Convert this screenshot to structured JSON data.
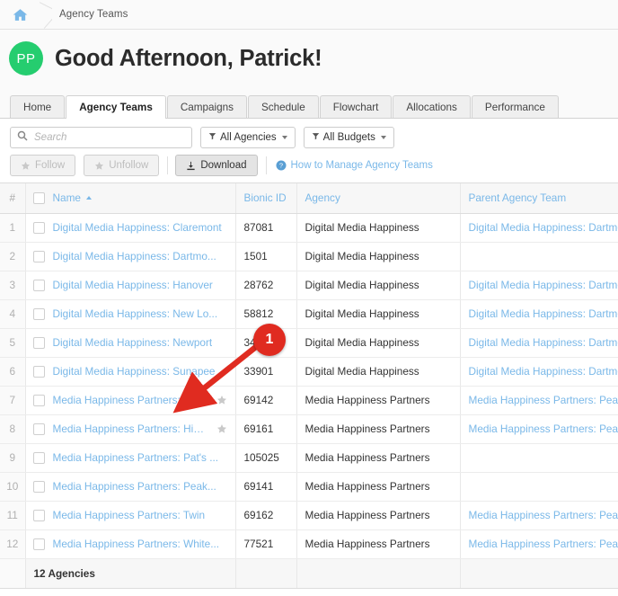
{
  "breadcrumb": {
    "home_icon": "home-icon",
    "label": "Agency Teams"
  },
  "greeting": {
    "avatar_initials": "PP",
    "avatar_color": "#25cd6f",
    "text": "Good Afternoon, Patrick!"
  },
  "tabs": [
    {
      "label": "Home",
      "active": false
    },
    {
      "label": "Agency Teams",
      "active": true
    },
    {
      "label": "Campaigns",
      "active": false
    },
    {
      "label": "Schedule",
      "active": false
    },
    {
      "label": "Flowchart",
      "active": false
    },
    {
      "label": "Allocations",
      "active": false
    },
    {
      "label": "Performance",
      "active": false
    }
  ],
  "toolbar": {
    "search_placeholder": "Search",
    "search_value": "",
    "search_icon": "search-icon",
    "filter_agencies": "All Agencies",
    "filter_budgets": "All Budgets",
    "follow_label": "Follow",
    "unfollow_label": "Unfollow",
    "download_label": "Download",
    "help_label": "How to Manage Agency Teams",
    "help_icon": "question-circle-icon",
    "follow_enabled": false,
    "unfollow_enabled": false,
    "download_enabled": true
  },
  "table": {
    "headers": {
      "num": "#",
      "name": "Name",
      "bionic_id": "Bionic ID",
      "agency": "Agency",
      "parent": "Parent Agency Team"
    },
    "sort_column": "Name",
    "sort_direction": "asc",
    "rows": [
      {
        "num": "1",
        "name": "Digital Media Happiness: Claremont",
        "bionic_id": "87081",
        "agency": "Digital Media Happiness",
        "parent": "Digital Media Happiness: Dartmo...",
        "starred": false
      },
      {
        "num": "2",
        "name": "Digital Media Happiness: Dartmo...",
        "bionic_id": "1501",
        "agency": "Digital Media Happiness",
        "parent": "",
        "starred": false
      },
      {
        "num": "3",
        "name": "Digital Media Happiness: Hanover",
        "bionic_id": "28762",
        "agency": "Digital Media Happiness",
        "parent": "Digital Media Happiness: Dartmo...",
        "starred": false
      },
      {
        "num": "4",
        "name": "Digital Media Happiness: New Lo...",
        "bionic_id": "58812",
        "agency": "Digital Media Happiness",
        "parent": "Digital Media Happiness: Dartmo...",
        "starred": false
      },
      {
        "num": "5",
        "name": "Digital Media Happiness: Newport",
        "bionic_id": "34",
        "agency": "Digital Media Happiness",
        "parent": "Digital Media Happiness: Dartmo...",
        "starred": false
      },
      {
        "num": "6",
        "name": "Digital Media Happiness: Sunapee",
        "bionic_id": "33901",
        "agency": "Digital Media Happiness",
        "parent": "Digital Media Happiness: Dartmo...",
        "starred": false
      },
      {
        "num": "7",
        "name": "Media Happiness Partners: Everest",
        "bionic_id": "69142",
        "agency": "Media Happiness Partners",
        "parent": "Media Happiness Partners: Peak...",
        "starred": true
      },
      {
        "num": "8",
        "name": "Media Happiness Partners: Highest",
        "bionic_id": "69161",
        "agency": "Media Happiness Partners",
        "parent": "Media Happiness Partners: Peak...",
        "starred": true
      },
      {
        "num": "9",
        "name": "Media Happiness Partners: Pat's ...",
        "bionic_id": "105025",
        "agency": "Media Happiness Partners",
        "parent": "",
        "starred": false
      },
      {
        "num": "10",
        "name": "Media Happiness Partners: Peak...",
        "bionic_id": "69141",
        "agency": "Media Happiness Partners",
        "parent": "",
        "starred": false
      },
      {
        "num": "11",
        "name": "Media Happiness Partners: Twin",
        "bionic_id": "69162",
        "agency": "Media Happiness Partners",
        "parent": "Media Happiness Partners: Peak...",
        "starred": false
      },
      {
        "num": "12",
        "name": "Media Happiness Partners: White...",
        "bionic_id": "77521",
        "agency": "Media Happiness Partners",
        "parent": "Media Happiness Partners: Peak...",
        "starred": false
      }
    ],
    "footer_total": "12 Agencies"
  },
  "annotation": {
    "badge_number": "1",
    "badge_color": "#e02b20"
  }
}
